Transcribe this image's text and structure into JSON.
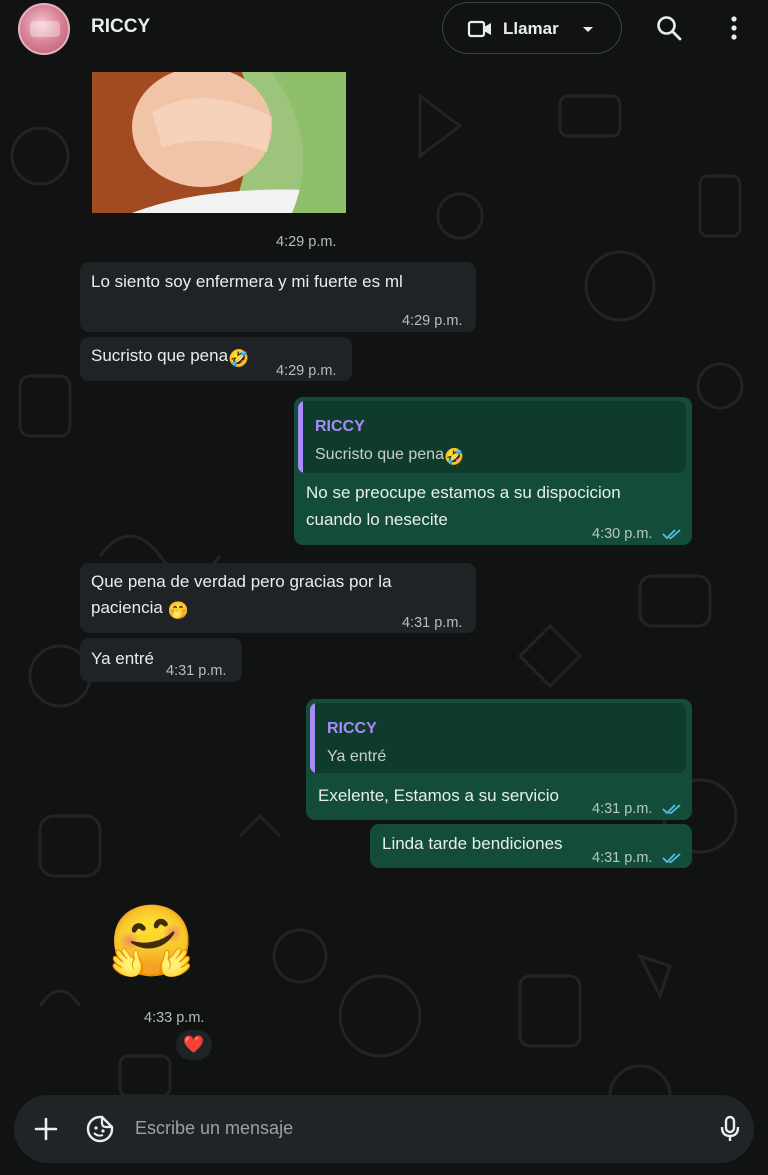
{
  "header": {
    "contact_name": "RICCY",
    "call_label": "Llamar"
  },
  "messages": [
    {
      "time": "4:29 p.m."
    },
    {
      "text": "Lo siento soy enfermera y mi fuerte es ml",
      "time": "4:29 p.m."
    },
    {
      "text": "Sucristo que pena",
      "emoji": "🤣",
      "time": "4:29 p.m."
    },
    {
      "quote_name": "RICCY",
      "quote_text": "Sucristo que pena",
      "quote_emoji": "🤣",
      "line1": "No se preocupe estamos a su dispocicion",
      "line2": "cuando lo nesecite",
      "time": "4:30 p.m."
    },
    {
      "line1": "Que pena de verdad pero gracias por la",
      "line2": "paciencia",
      "emoji": "🤭",
      "time": "4:31 p.m."
    },
    {
      "text": "Ya entré",
      "time": "4:31 p.m."
    },
    {
      "quote_name": "RICCY",
      "quote_text": "Ya entré",
      "text": "Exelente, Estamos a su servicio",
      "time": "4:31 p.m."
    },
    {
      "text": "Linda tarde bendiciones",
      "time": "4:31 p.m."
    },
    {
      "emoji": "🤗",
      "time": "4:33 p.m.",
      "reaction": "❤️"
    }
  ],
  "composer": {
    "placeholder": "Escribe un mensaje"
  },
  "colors": {
    "background": "#111313",
    "incoming_bubble": "#1f2326",
    "outgoing_bubble": "#134d3a",
    "quote_name": "#a78bfa",
    "read_ticks": "#53bdeb"
  },
  "icons": [
    "video-icon",
    "chevron-down-icon",
    "search-icon",
    "more-vertical-icon",
    "plus-icon",
    "sticker-icon",
    "mic-icon",
    "double-check-icon"
  ]
}
